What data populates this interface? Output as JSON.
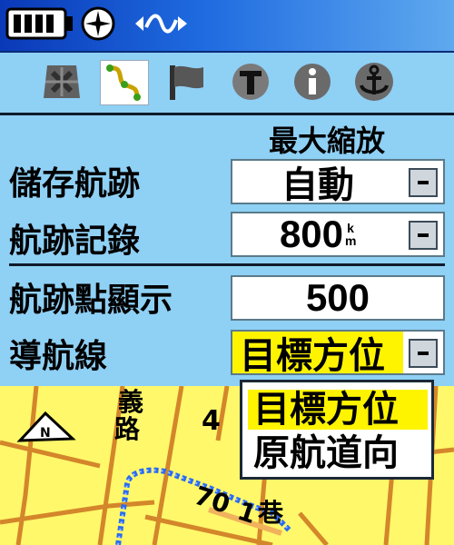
{
  "status": {
    "icons": [
      "battery-icon",
      "compass-icon",
      "signal-icon"
    ]
  },
  "tabs": [
    {
      "icon": "map-icon"
    },
    {
      "icon": "track-icon",
      "active": true
    },
    {
      "icon": "flag-icon"
    },
    {
      "icon": "text-icon"
    },
    {
      "icon": "info-icon"
    },
    {
      "icon": "anchor-icon"
    }
  ],
  "settings": {
    "zoom_header": "最大縮放",
    "save_track": {
      "label": "儲存航跡",
      "value": "自動"
    },
    "track_log": {
      "label": "航跡記錄",
      "value": "800",
      "unit_top": "k",
      "unit_bottom": "m"
    },
    "track_points_display": {
      "label": "航跡點顯示",
      "value": "500"
    },
    "nav_line": {
      "label": "導航線",
      "value": "目標方位"
    }
  },
  "dropdown": {
    "options": [
      "目標方位",
      "原航道向"
    ],
    "selected_index": 0
  },
  "map": {
    "labels": [
      "義",
      "路",
      "4",
      "70",
      "1",
      "巷"
    ]
  },
  "colors": {
    "background": "#8fd0f5",
    "map": "#fff86a",
    "highlight": "#fff400",
    "track": "#2a6cf0",
    "road": "#d4862b"
  }
}
